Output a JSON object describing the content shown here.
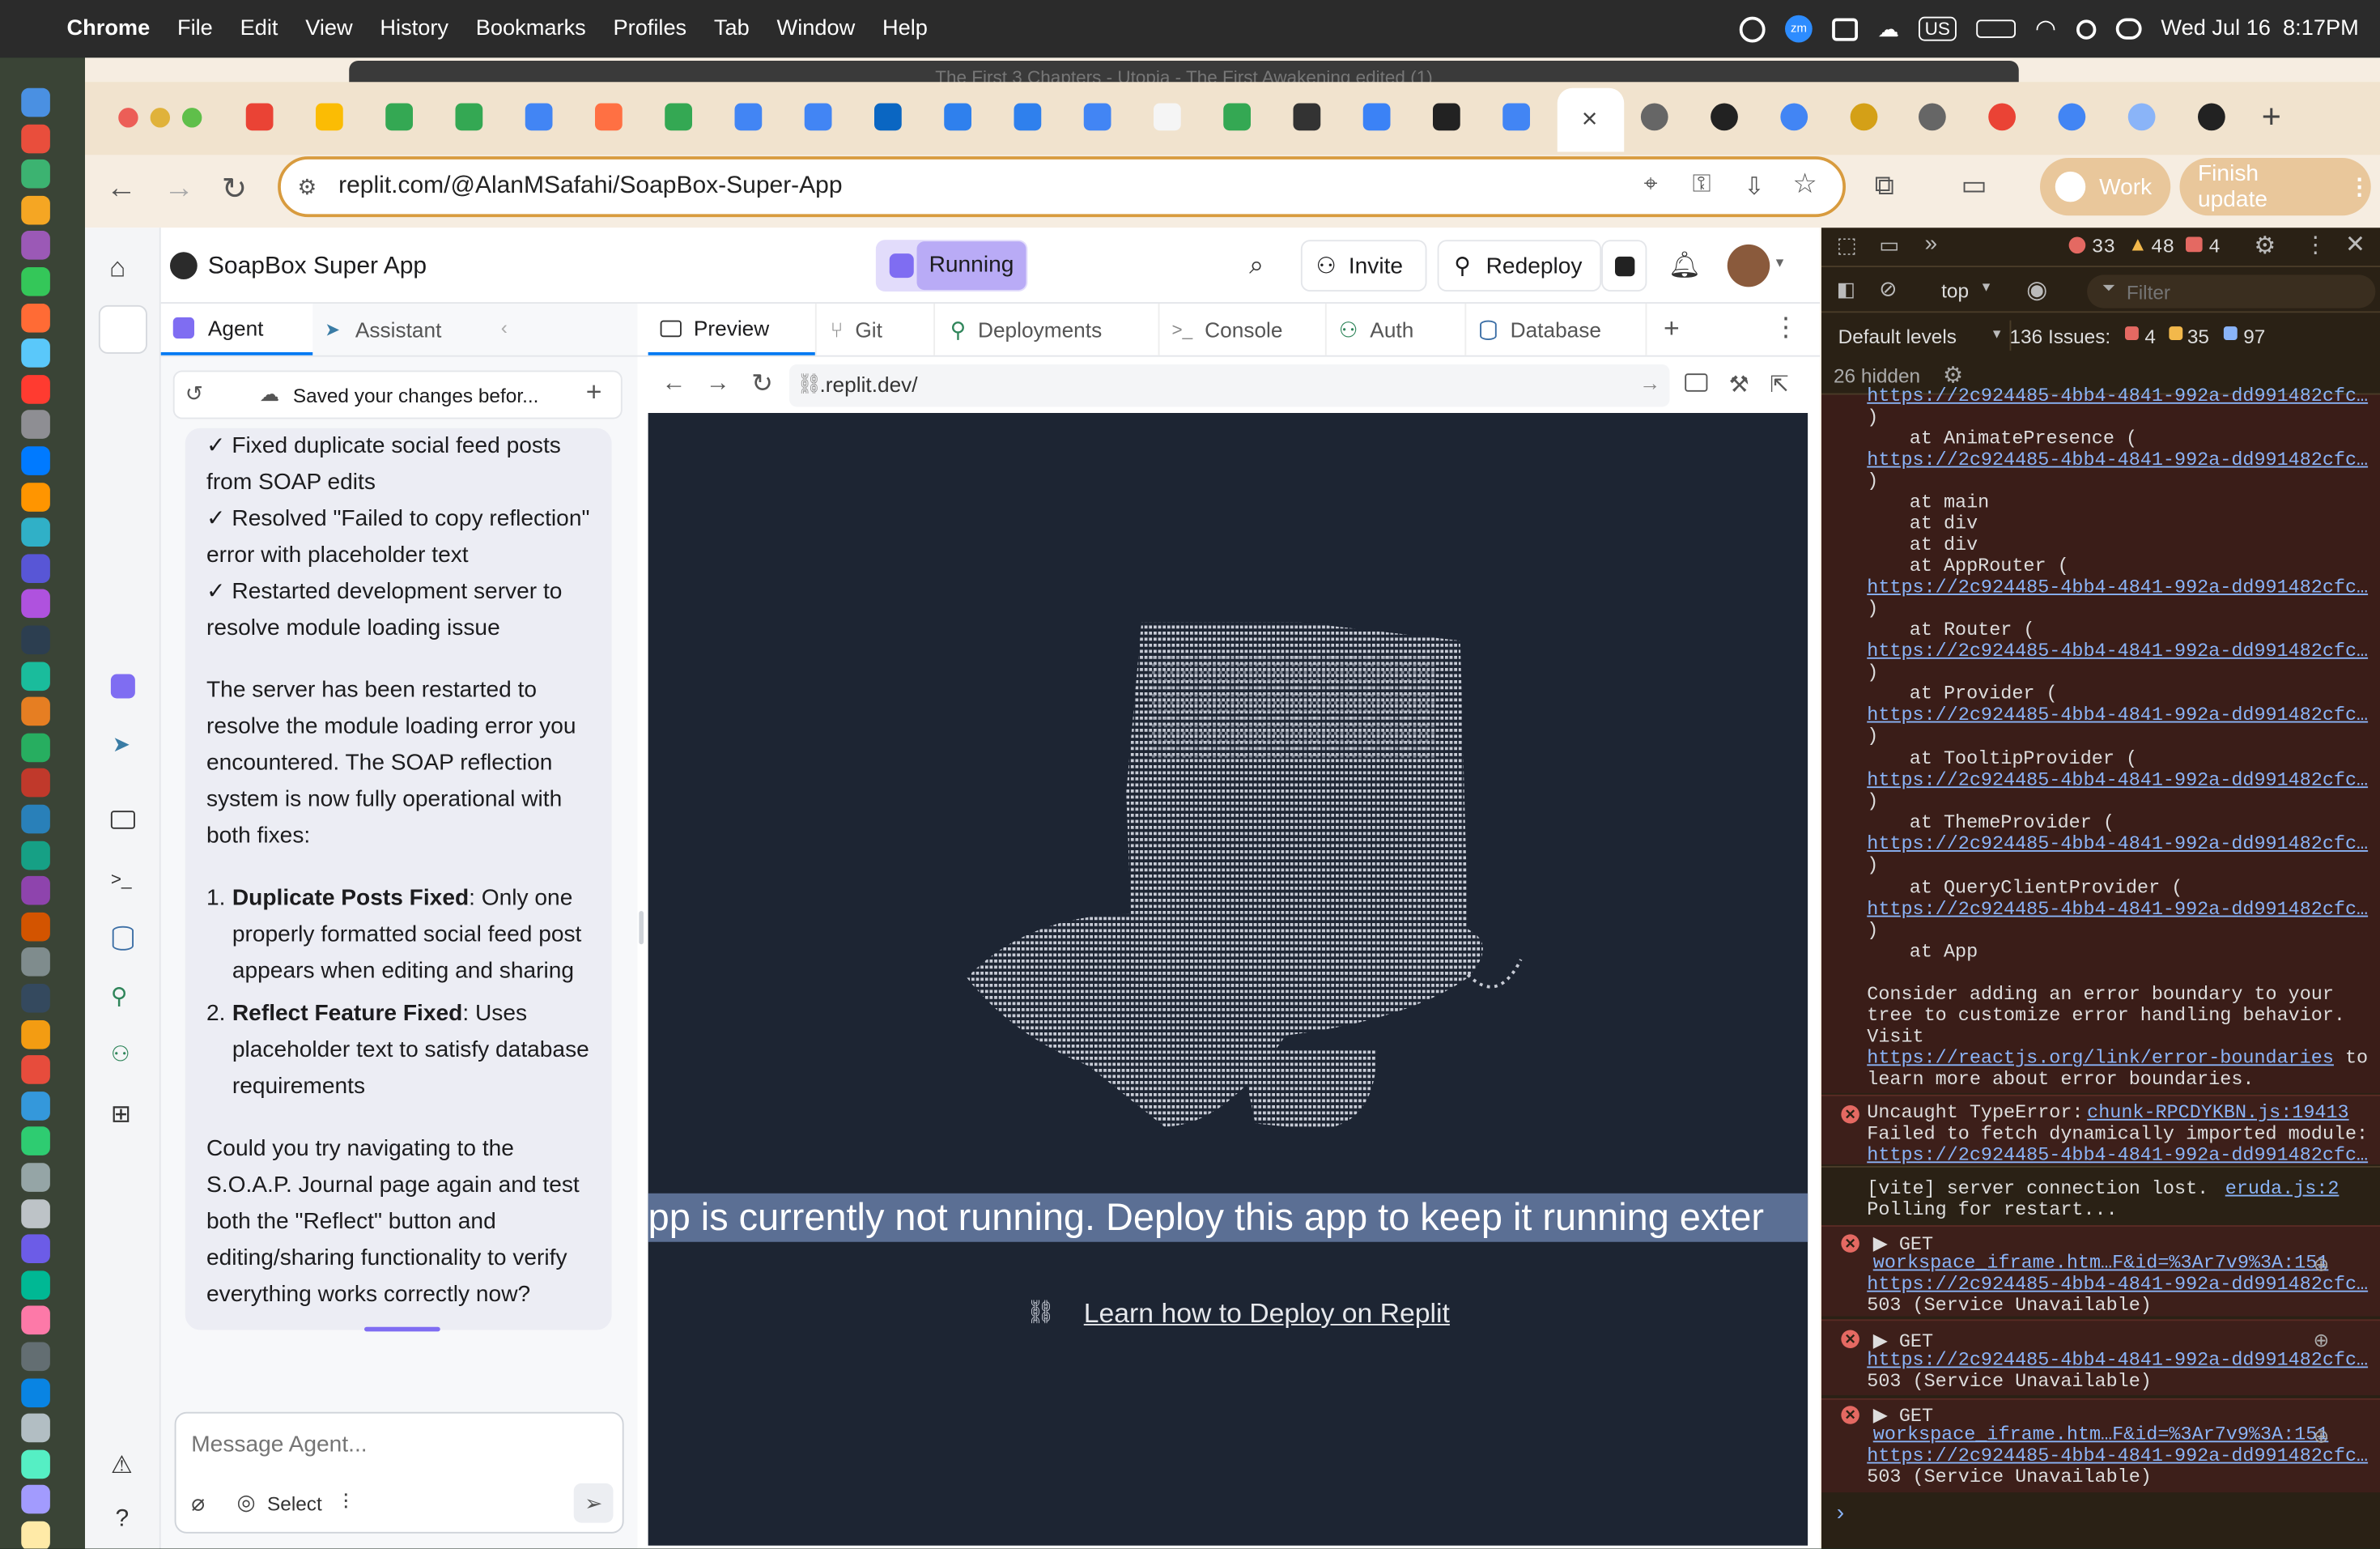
{
  "menubar": {
    "app": "Chrome",
    "items": [
      "File",
      "Edit",
      "View",
      "History",
      "Bookmarks",
      "Profiles",
      "Tab",
      "Window",
      "Help"
    ],
    "datetime": "Wed Jul 16  8:17PM",
    "keyboard": "US",
    "zoom_badge": "zm"
  },
  "background_window_title": "The First 3 Chapters - Utopia - The First Awakening edited (1)",
  "browser": {
    "url": "replit.com/@AlanMSafahi/SoapBox-Super-App",
    "profile_label": "Work",
    "update_label": "Finish update"
  },
  "replit": {
    "project_name": "SoapBox Super App",
    "run_status": "Running",
    "invite_label": "Invite",
    "redeploy_label": "Redeploy",
    "left_tabs": [
      "Agent",
      "Assistant"
    ],
    "history_text": "Saved your changes befor...",
    "chat": {
      "checks": [
        "✓ Fixed duplicate social feed posts from SOAP edits",
        "✓ Resolved \"Failed to copy reflection\" error with placeholder text",
        "✓ Restarted development server to resolve module loading issue"
      ],
      "paragraph": "The server has been restarted to resolve the module loading error you encountered. The SOAP reflection system is now fully operational with both fixes:",
      "fixes": [
        {
          "num": "1.",
          "title": "Duplicate Posts Fixed",
          "text": ": Only one properly formatted social feed post appears when editing and sharing"
        },
        {
          "num": "2.",
          "title": "Reflect Feature Fixed",
          "text": ": Uses placeholder text to satisfy database requirements"
        }
      ],
      "closing": "Could you try navigating to the S.O.A.P. Journal page again and test both the \"Reflect\" button and editing/sharing functionality to verify everything works correctly now?"
    },
    "message_placeholder": "Message Agent...",
    "select_label": "Select",
    "workspace_tabs": [
      "Preview",
      "Git",
      "Deployments",
      "Console",
      "Auth",
      "Database"
    ],
    "preview_url": ".replit.dev/",
    "banner_text": "pp is currently not running. Deploy this app to keep it running exter",
    "deploy_link": "Learn how to Deploy on Replit"
  },
  "devtools": {
    "error_count": "33",
    "warning_count": "48",
    "issue_count_top": "4",
    "context": "top",
    "filter_placeholder": "Filter",
    "levels": "Default levels",
    "issues_label": "136 Issues:",
    "issues_err": "4",
    "issues_warn": "35",
    "issues_info": "97",
    "hidden": "26 hidden",
    "stack_link": "https://2c924485-4bb4-4841-992a-dd991482cfc…",
    "stack": [
      "at AnimatePresence (",
      "at main",
      "at div",
      "at div",
      "at AppRouter (",
      "at Router (",
      "at Provider (",
      "at TooltipProvider (",
      "at ThemeProvider (",
      "at QueryClientProvider (",
      "at App"
    ],
    "boundary_lines": [
      "Consider adding an error boundary to your",
      "tree to customize error handling behavior.",
      "Visit"
    ],
    "boundary_link": "https://reactjs.org/link/error-boundaries",
    "boundary_to": " to",
    "boundary_end": "learn more about error boundaries.",
    "uncaught": "Uncaught TypeError:",
    "uncaught_src": "chunk-RPCDYKBN.js:19413",
    "uncaught_msg": "Failed to fetch dynamically imported module:",
    "vite_msg": "[vite] server connection lost.",
    "vite_src": "eruda.js:2",
    "vite_msg2": "Polling for restart...",
    "get": "▶ GET",
    "iframe_link": "workspace_iframe.htm…F&id=%3Ar7v9%3A:151",
    "status_503": "503 (Service Unavailable)",
    "prompt": "›"
  }
}
